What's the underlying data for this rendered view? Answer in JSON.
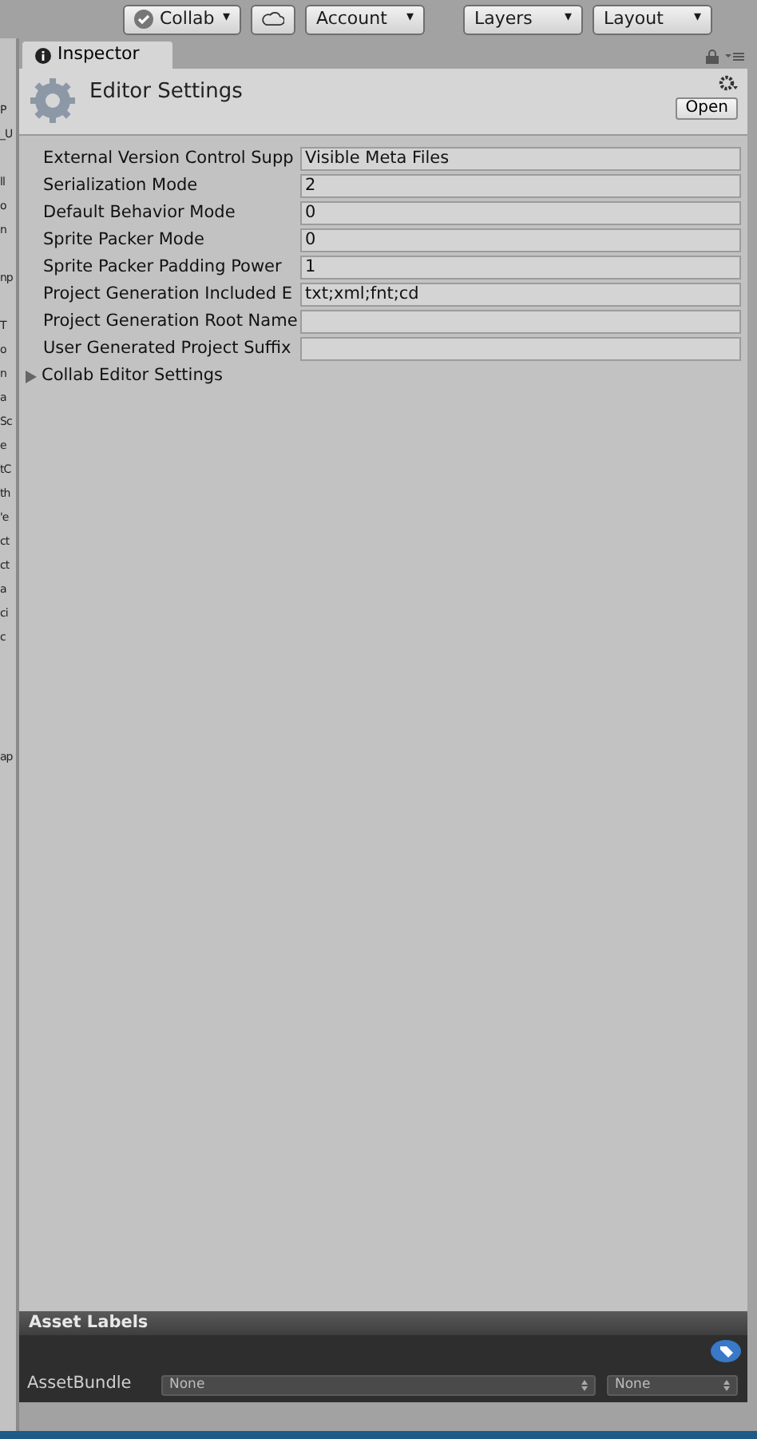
{
  "toolbar": {
    "buttons": [
      {
        "kind": "collab",
        "label": "Collab",
        "caret": "▾"
      },
      {
        "kind": "cloud"
      },
      {
        "kind": "dropdown",
        "label": "Account",
        "caret": "▾"
      },
      {
        "kind": "dropdown",
        "label": "Layers",
        "caret": "▾"
      },
      {
        "kind": "dropdown",
        "label": "Layout",
        "caret": "▾"
      }
    ]
  },
  "left_panel_fragments": [
    "P",
    "_U",
    "ll",
    "o",
    "n",
    "np",
    "T",
    "o",
    "n",
    "a",
    "Sc",
    "e",
    "tC",
    "th",
    "'e",
    "ct",
    "ct",
    "a",
    "ci",
    "c",
    "ap"
  ],
  "tab": {
    "label": "Inspector",
    "selected": true
  },
  "header": {
    "title": "Editor Settings",
    "open_button": "Open"
  },
  "properties": [
    {
      "label": "External Version Control Supp",
      "value": "Visible Meta Files"
    },
    {
      "label": "Serialization Mode",
      "value": "2"
    },
    {
      "label": "Default Behavior Mode",
      "value": "0"
    },
    {
      "label": "Sprite Packer Mode",
      "value": "0"
    },
    {
      "label": "Sprite Packer Padding Power",
      "value": "1"
    },
    {
      "label": "Project Generation Included E",
      "value": "txt;xml;fnt;cd"
    },
    {
      "label": "Project Generation Root Name"
    },
    {
      "label": "User Generated Project Suffix"
    }
  ],
  "foldout": {
    "label": "Collab Editor Settings",
    "expanded": false
  },
  "asset_labels": {
    "title": "Asset Labels",
    "bundle_label": "AssetBundle",
    "bundle_name": "None",
    "bundle_variant": "None"
  }
}
